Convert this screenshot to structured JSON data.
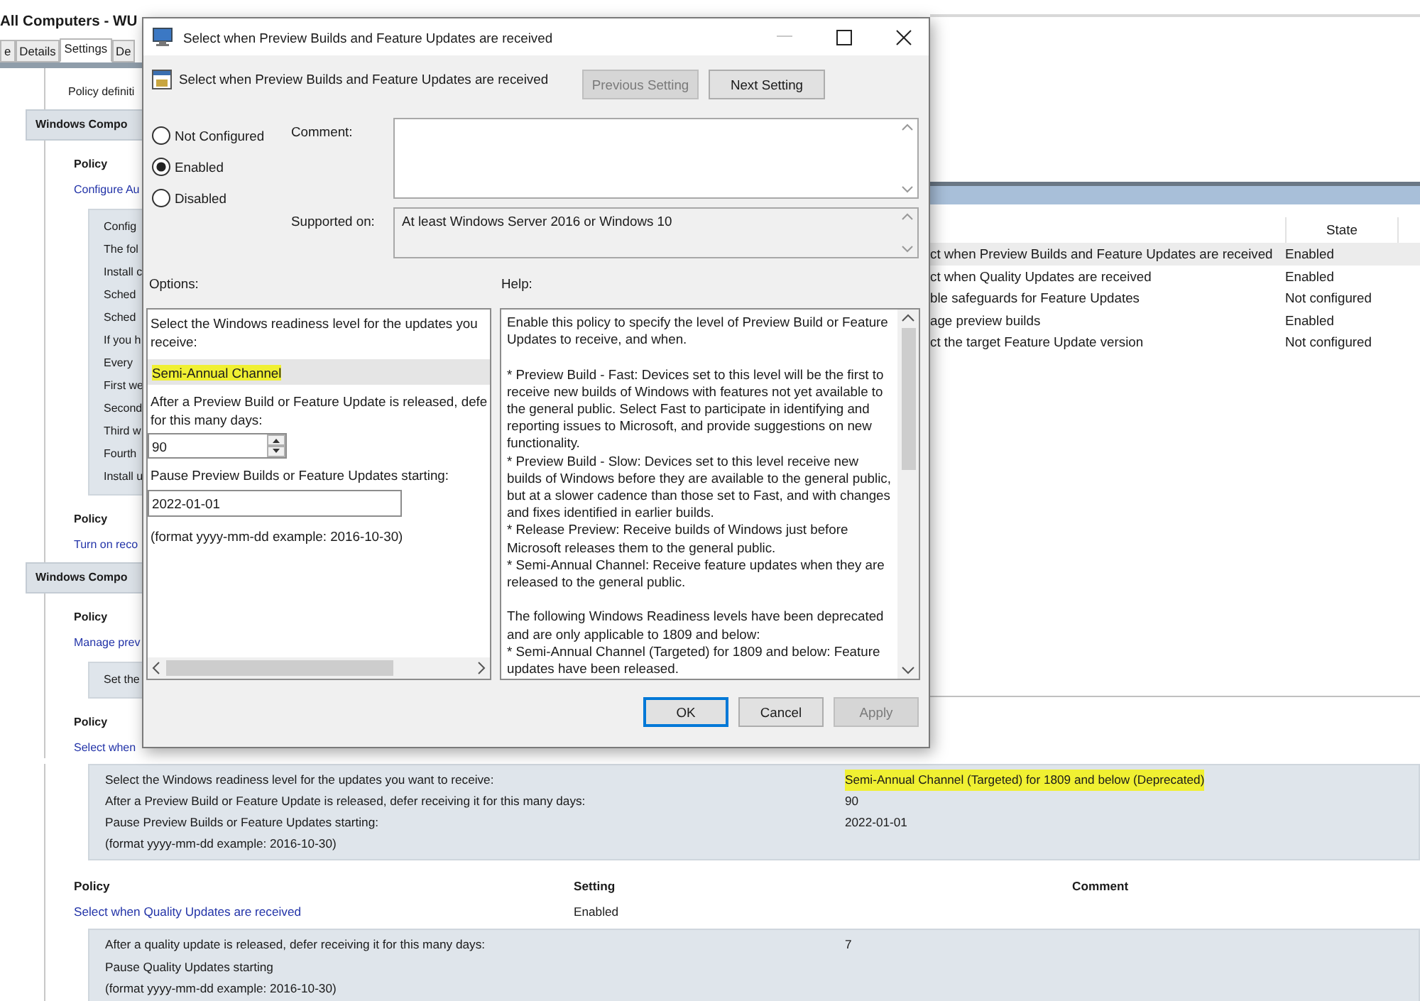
{
  "report": {
    "title": "All Computers - WU",
    "tabs": [
      {
        "label": "e",
        "selected": false
      },
      {
        "label": "Details",
        "selected": false
      },
      {
        "label": "Settings",
        "selected": true
      },
      {
        "label": "De",
        "selected": false
      }
    ],
    "upper_blocks": [
      {
        "kind": "text",
        "text": "Policy definiti"
      },
      {
        "kind": "section",
        "text": "Windows Compo"
      },
      {
        "kind": "heading",
        "text": "Policy"
      },
      {
        "kind": "link",
        "text": "Configure Au"
      },
      {
        "kind": "details",
        "lines": [
          "Config",
          "The fol",
          "Install c",
          "Sched",
          "Sched",
          "If you h",
          "Every",
          "First we",
          "Second",
          "Third w",
          "Fourth",
          "Install u"
        ]
      },
      {
        "kind": "heading",
        "text": "Policy"
      },
      {
        "kind": "link",
        "text": "Turn on reco"
      },
      {
        "kind": "section",
        "text": "Windows Compo"
      },
      {
        "kind": "heading",
        "text": "Policy"
      },
      {
        "kind": "link",
        "text": "Manage prev"
      },
      {
        "kind": "details",
        "lines": [
          "Set the"
        ]
      },
      {
        "kind": "heading",
        "text": "Policy"
      },
      {
        "kind": "link",
        "text": "Select when"
      }
    ],
    "preview_details": [
      {
        "label": "Select the Windows readiness level for the updates you want to receive:",
        "value": "Semi-Annual Channel (Targeted) for 1809 and below (Deprecated)",
        "highlighted": true
      },
      {
        "label": "After a Preview Build or Feature Update is released, defer receiving it for this many days:",
        "value": "90",
        "highlighted": false
      },
      {
        "label": "Pause Preview Builds or Feature Updates starting:",
        "value": "2022-01-01",
        "highlighted": false
      },
      {
        "label": "(format yyyy-mm-dd example: 2016-10-30)",
        "highlighted": false
      }
    ],
    "policy_table": {
      "columns": [
        "Policy",
        "Setting",
        "Comment"
      ],
      "rows": [
        {
          "policy": "Select when Quality Updates are received",
          "setting": "Enabled"
        }
      ]
    },
    "quality_details": [
      {
        "label": "After a quality update is released, defer receiving it for this many days:",
        "value": "7",
        "highlighted": false
      },
      {
        "label": "Pause Quality Updates starting",
        "highlighted": false
      },
      {
        "label": "(format yyyy-mm-dd example: 2016-10-30)",
        "highlighted": false
      }
    ]
  },
  "editor": {
    "column": "State",
    "rows": [
      {
        "name": "ct when Preview Builds and Feature Updates are received",
        "state": "Enabled",
        "selected": true
      },
      {
        "name": "ct when Quality Updates are received",
        "state": "Enabled",
        "selected": false
      },
      {
        "name": "ble safeguards for Feature Updates",
        "state": "Not configured",
        "selected": false
      },
      {
        "name": "age preview builds",
        "state": "Enabled",
        "selected": false
      },
      {
        "name": "ct the target Feature Update version",
        "state": "Not configured",
        "selected": false
      }
    ]
  },
  "dialog": {
    "title": "Select when Preview Builds and Feature Updates are received",
    "heading": "Select when Preview Builds and Feature Updates are received",
    "nav_buttons": [
      {
        "label": "Previous Setting",
        "disabled": true
      },
      {
        "label": "Next Setting",
        "disabled": false
      }
    ],
    "radios": [
      {
        "label": "Not Configured",
        "selected": false
      },
      {
        "label": "Enabled",
        "selected": true
      },
      {
        "label": "Disabled",
        "selected": false
      }
    ],
    "comment_label": "Comment:",
    "supported_label": "Supported on:",
    "supported_value": "At least Windows Server 2016 or Windows 10",
    "options_label": "Options:",
    "help_label": "Help:",
    "options": [
      {
        "kind": "text",
        "lines": [
          "Select the Windows readiness level for the updates you",
          "receive:"
        ]
      },
      {
        "kind": "dropdown",
        "value": "Semi-Annual Channel",
        "highlighted": true
      },
      {
        "kind": "text",
        "lines": [
          "After a Preview Build or Feature Update is released, defe",
          "for this many days:"
        ]
      },
      {
        "kind": "spin",
        "value": "90"
      },
      {
        "kind": "text",
        "lines": [
          "Pause Preview Builds or Feature Updates starting:"
        ]
      },
      {
        "kind": "input",
        "value": "2022-01-01"
      },
      {
        "kind": "text",
        "lines": [
          "(format yyyy-mm-dd example: 2016-10-30)"
        ]
      }
    ],
    "help": "Enable this policy to specify the level of Preview Build or Feature Updates to receive, and when.\n\n* Preview Build - Fast: Devices set to this level will be the first to receive new builds of Windows with features not yet available to the general public. Select Fast to participate in identifying and reporting issues to Microsoft, and provide suggestions on new functionality.\n* Preview Build - Slow: Devices set to this level receive new builds of Windows before they are available to the general public, but at a slower cadence than those set to Fast, and with changes and fixes identified in earlier builds.\n* Release Preview: Receive builds of Windows just before Microsoft releases them to the general public.\n* Semi-Annual Channel: Receive feature updates when they are released to the general public.\n\nThe following Windows Readiness levels have been deprecated and are only applicable to 1809 and below:\n* Semi-Annual Channel (Targeted) for 1809 and below: Feature updates have been released.",
    "footer_buttons": [
      {
        "label": "OK",
        "default": true,
        "disabled": false
      },
      {
        "label": "Cancel",
        "default": false,
        "disabled": false
      },
      {
        "label": "Apply",
        "default": false,
        "disabled": true
      }
    ]
  }
}
